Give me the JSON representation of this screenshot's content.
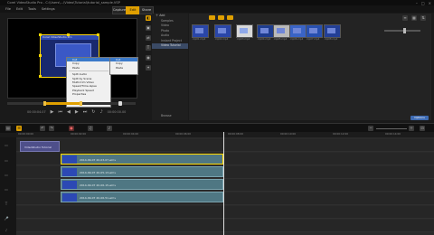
{
  "window": {
    "title": "Corel VideoStudio Pro - C:\\Users\\...\\Video\\Tutorial\\tutorial_sample.VSP"
  },
  "menu": {
    "items": [
      "File",
      "Edit",
      "Tools",
      "Settings"
    ]
  },
  "steps": {
    "capture": "Capture",
    "edit": "Edit",
    "share": "Share"
  },
  "context_menu": {
    "items": [
      "Cut",
      "Copy",
      "Paste",
      "Split Audio",
      "Split by Scene",
      "Multi-trim Video",
      "Speed/Time-lapse",
      "Playback Speed",
      "Properties"
    ],
    "highlighted_index": 0
  },
  "submenu": {
    "items": [
      "Cut",
      "Copy",
      "Paste"
    ],
    "highlighted_index": 0
  },
  "preview": {
    "clip_heading": "Corel VideoStudio Pro"
  },
  "playback": {
    "timecode_left": "00:00:04.07",
    "timecode_right": "00:00:00.00",
    "scrub_position": 0.48
  },
  "library": {
    "add_label": "Add",
    "folders": [
      "Samples",
      "Video",
      "Photo",
      "Audio",
      "Instant Project",
      "Video Tutorial"
    ],
    "selected_index": 5,
    "browse_label": "Browse",
    "options_label": "Options",
    "thumbs": [
      "clip01.mp4",
      "clip02.mp4",
      "clip03.mp4",
      "clip04.mp4",
      "clip05.mp4",
      "clip06.mp4",
      "clip07.mp4",
      "clip08.mp4"
    ]
  },
  "timeline": {
    "title_clip": "VideoStudio Tutorial",
    "clips": [
      "2014-09-07 20-03-07.wmv",
      "2014-09-07 20-05-13.wmv",
      "2014-09-07 20-06-15.wmv",
      "2014-09-07 20-06-51.wmv"
    ],
    "ruler": [
      "00:00:00:00",
      "00:00:02:00",
      "00:00:04:00",
      "00:00:06:00",
      "00:00:08:00",
      "00:00:10:00",
      "00:00:12:00",
      "00:00:14:00"
    ]
  },
  "colors": {
    "accent": "#e0a000",
    "clip": "#4f7783",
    "title_clip": "#4e4f8a",
    "selection": "#ffd800"
  }
}
